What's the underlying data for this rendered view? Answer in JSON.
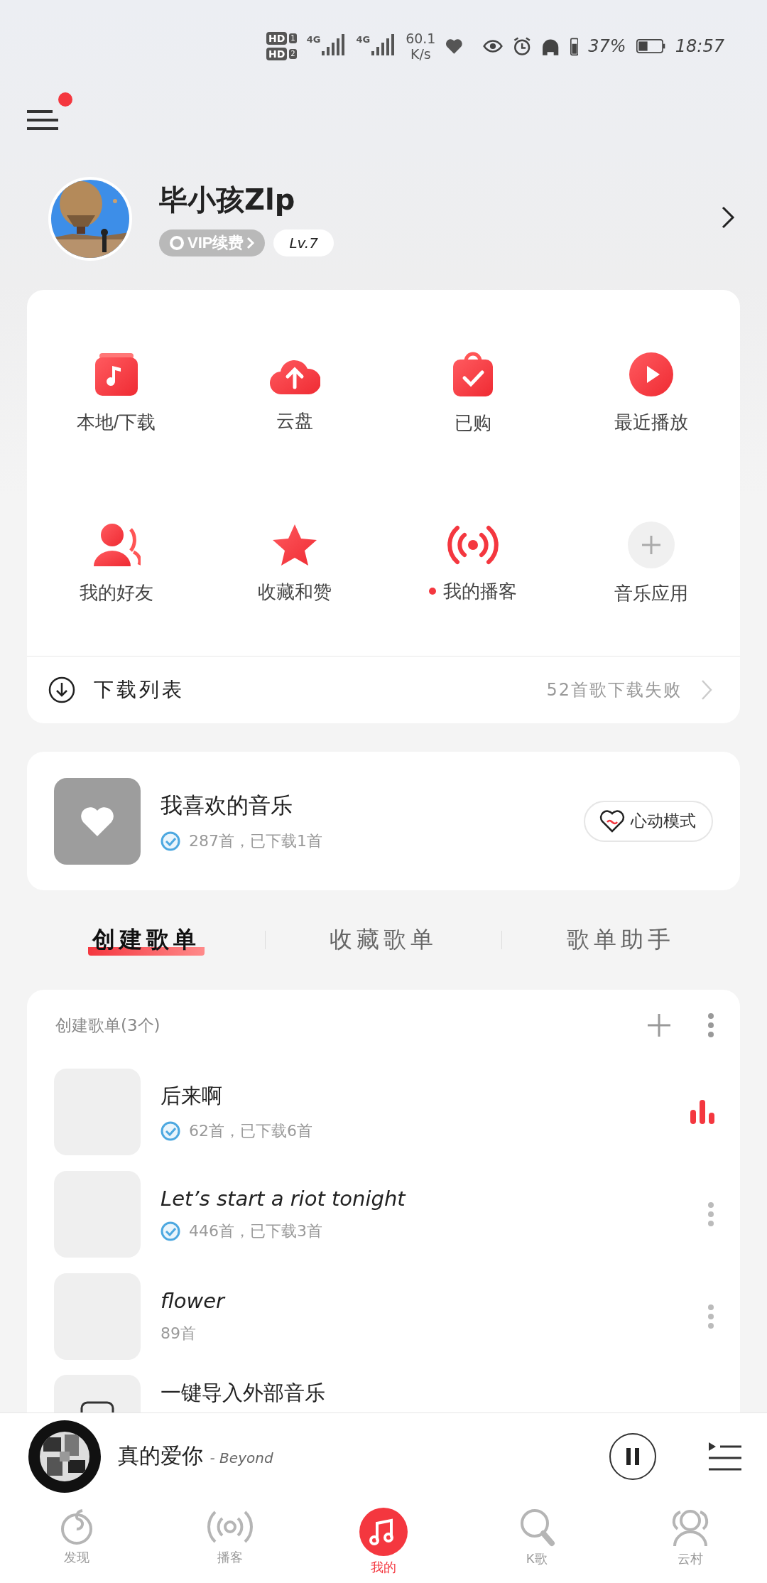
{
  "status_bar": {
    "sims": [
      {
        "label": "HD",
        "slot": "1"
      },
      {
        "label": "HD",
        "slot": "2"
      }
    ],
    "networks": [
      "4G",
      "4G"
    ],
    "speed": "60.1",
    "speed_unit": "K/s",
    "battery": "37%",
    "time": "18:57"
  },
  "menu": {
    "notification": true
  },
  "profile": {
    "name": "毕小孩Zlp",
    "vip": "VIP续费",
    "level": "Lv.7"
  },
  "shortcuts": [
    {
      "label": "本地/下载",
      "kind": "music",
      "dot": false
    },
    {
      "label": "云盘",
      "kind": "cloud",
      "dot": false
    },
    {
      "label": "已购",
      "kind": "bag",
      "dot": false
    },
    {
      "label": "最近播放",
      "kind": "play",
      "dot": false
    },
    {
      "label": "我的好友",
      "kind": "friends",
      "dot": false
    },
    {
      "label": "收藏和赞",
      "kind": "star",
      "dot": false
    },
    {
      "label": "我的播客",
      "kind": "radio",
      "dot": true
    },
    {
      "label": "音乐应用",
      "kind": "add",
      "dot": false
    }
  ],
  "downloads": {
    "label": "下载列表",
    "status": "52首歌下载失败"
  },
  "liked": {
    "title": "我喜欢的音乐",
    "info": "287首，已下载1首",
    "downloaded": true,
    "button": "心动模式"
  },
  "tabs": [
    {
      "label": "创建歌单",
      "selected": true
    },
    {
      "label": "收藏歌单",
      "selected": false
    },
    {
      "label": "歌单助手",
      "selected": false
    }
  ],
  "playlists": {
    "header": "创建歌单(3个)",
    "rows": [
      {
        "kind": "playlist",
        "title": "后来啊",
        "info": "62首，已下载6首",
        "downloaded": true,
        "playing": true
      },
      {
        "kind": "playlist",
        "title": "Let’s start a riot tonight",
        "info": "446首，已下载3首",
        "downloaded": true,
        "playing": false
      },
      {
        "kind": "playlist",
        "title": "flower",
        "info": "89首",
        "downloaded": false,
        "playing": false
      },
      {
        "kind": "import",
        "title": "一键导入外部音乐"
      }
    ]
  },
  "player": {
    "title": "真的爱你",
    "artist": "- Beyond",
    "playing": true
  },
  "nav": [
    {
      "label": "发现",
      "kind": "discover",
      "selected": false
    },
    {
      "label": "播客",
      "kind": "podcast",
      "selected": false
    },
    {
      "label": "我的",
      "kind": "mine",
      "selected": true
    },
    {
      "label": "K歌",
      "kind": "mic",
      "selected": false
    },
    {
      "label": "云村",
      "kind": "people",
      "selected": false
    }
  ]
}
